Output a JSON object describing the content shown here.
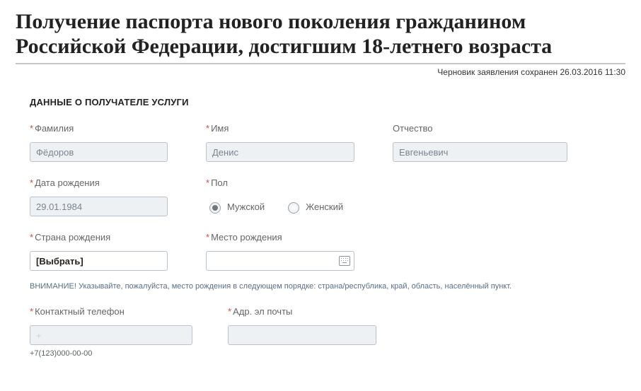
{
  "title": "Получение паспорта нового поколения гражданином Российской Федерации, достигшим 18-летнего возраста",
  "saved": "Черновик заявления сохранен 26.03.2016 11:30",
  "section_heading": "ДАННЫЕ О ПОЛУЧАТЕЛЕ УСЛУГИ",
  "labels": {
    "surname": "Фамилия",
    "name": "Имя",
    "patronymic": "Отчество",
    "dob": "Дата рождения",
    "sex": "Пол",
    "country": "Страна рождения",
    "place": "Место рождения",
    "phone": "Контактный телефон",
    "email": "Адр. эл почты"
  },
  "values": {
    "surname": "Фёдоров",
    "name": "Денис",
    "patronymic": "Евгеньевич",
    "dob": "29.01.1984",
    "country_select": "[Выбрать]",
    "place": "",
    "phone": "+",
    "email": ""
  },
  "sex_options": {
    "male": "Мужской",
    "female": "Женский"
  },
  "hint": "ВНИМАНИЕ! Указывайте, пожалуйста, место рождения в следующем порядке: страна/республика, край, область, населённый пункт.",
  "phone_format": "+7(123)000-00-00"
}
